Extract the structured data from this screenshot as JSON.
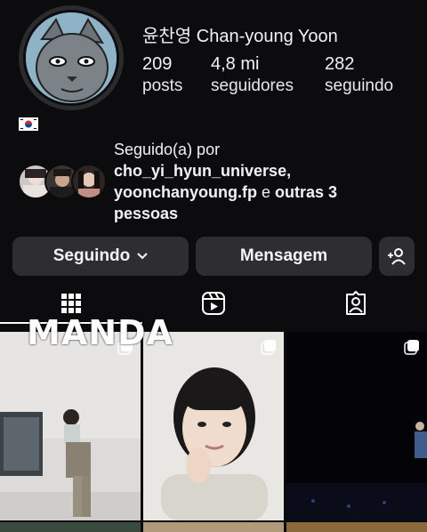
{
  "profile": {
    "display_name": "윤찬영 Chan-young Yoon",
    "stats": [
      {
        "value": "209",
        "label": "posts"
      },
      {
        "value": "4,8 mi",
        "label": "seguidores"
      },
      {
        "value": "282",
        "label": "seguindo"
      }
    ],
    "flag_icon": "south-korea-flag-icon"
  },
  "followed_by": {
    "title": "Seguido(a) por",
    "user1": "cho_yi_hyun_universe,",
    "user2": "yoonchanyoung.fp",
    "conj": " e ",
    "others": "outras 3",
    "others2": "pessoas"
  },
  "actions": {
    "following_label": "Seguindo",
    "message_label": "Mensagem",
    "add_icon": "add-person-icon"
  },
  "tabs": [
    {
      "name": "grid",
      "icon": "grid-icon",
      "active": true
    },
    {
      "name": "reels",
      "icon": "reels-icon"
    },
    {
      "name": "tagged",
      "icon": "tagged-icon"
    }
  ],
  "overlay": {
    "text": "MANDA"
  },
  "colors": {
    "background": "#0c0c0e",
    "button": "#2e2e31",
    "text": "#f2f2f2"
  }
}
